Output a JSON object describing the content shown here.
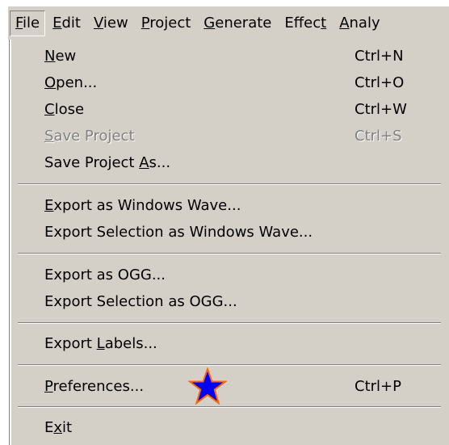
{
  "menubar": {
    "items": [
      {
        "pre": "",
        "mn": "F",
        "post": "ile"
      },
      {
        "pre": "",
        "mn": "E",
        "post": "dit"
      },
      {
        "pre": "",
        "mn": "V",
        "post": "iew"
      },
      {
        "pre": "",
        "mn": "P",
        "post": "roject"
      },
      {
        "pre": "",
        "mn": "G",
        "post": "enerate"
      },
      {
        "pre": "Effec",
        "mn": "t",
        "post": ""
      },
      {
        "pre": "",
        "mn": "A",
        "post": "naly"
      }
    ]
  },
  "file_menu": {
    "items": [
      {
        "pre": "",
        "mn": "N",
        "post": "ew",
        "shortcut": "Ctrl+N"
      },
      {
        "pre": "",
        "mn": "O",
        "post": "pen...",
        "shortcut": "Ctrl+O"
      },
      {
        "pre": "",
        "mn": "C",
        "post": "lose",
        "shortcut": "Ctrl+W"
      },
      {
        "pre": "",
        "mn": "S",
        "post": "ave Project",
        "shortcut": "Ctrl+S"
      },
      {
        "pre": "Save Project ",
        "mn": "A",
        "post": "s...",
        "shortcut": ""
      },
      {
        "pre": "",
        "mn": "E",
        "post": "xport as Windows Wave...",
        "shortcut": ""
      },
      {
        "pre": "Export Selection as Windows Wave...",
        "mn": "",
        "post": "",
        "shortcut": ""
      },
      {
        "pre": "Export as OGG...",
        "mn": "",
        "post": "",
        "shortcut": ""
      },
      {
        "pre": "Export Selection as OGG...",
        "mn": "",
        "post": "",
        "shortcut": ""
      },
      {
        "pre": "Export ",
        "mn": "L",
        "post": "abels...",
        "shortcut": ""
      },
      {
        "pre": "",
        "mn": "P",
        "post": "references...",
        "shortcut": "Ctrl+P"
      },
      {
        "pre": "E",
        "mn": "x",
        "post": "it",
        "shortcut": ""
      }
    ]
  },
  "colors": {
    "menu_bg": "#d4d0c8",
    "disabled_text": "#808080",
    "star_fill": "#0000ff",
    "star_outline": "#ff6600"
  },
  "icons": {
    "marker": "star-icon"
  }
}
